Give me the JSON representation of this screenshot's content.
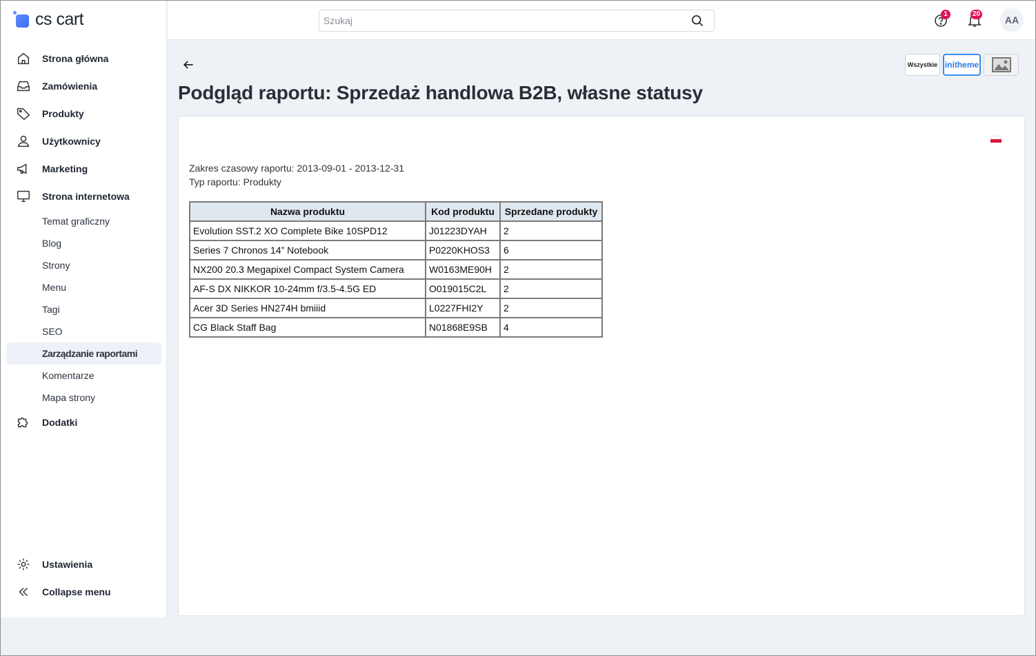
{
  "brand": {
    "name": "cs cart",
    "color": "#3f6ff2"
  },
  "search": {
    "placeholder": "Szukaj"
  },
  "topbar": {
    "help_badge": "1",
    "notifications_badge": "20",
    "avatar_initials": "AA"
  },
  "sidebar": {
    "items": [
      {
        "label": "Strona główna",
        "icon": "home-icon"
      },
      {
        "label": "Zamówienia",
        "icon": "inbox-icon"
      },
      {
        "label": "Produkty",
        "icon": "tag-icon"
      },
      {
        "label": "Użytkownicy",
        "icon": "user-icon"
      },
      {
        "label": "Marketing",
        "icon": "megaphone-icon"
      },
      {
        "label": "Strona internetowa",
        "icon": "monitor-icon"
      }
    ],
    "subitems": [
      {
        "label": "Temat graficzny"
      },
      {
        "label": "Blog"
      },
      {
        "label": "Strony"
      },
      {
        "label": "Menu"
      },
      {
        "label": "Tagi"
      },
      {
        "label": "SEO"
      },
      {
        "label": "Zarządzanie raportami",
        "active": true
      },
      {
        "label": "Komentarze"
      },
      {
        "label": "Mapa strony"
      }
    ],
    "addons": {
      "label": "Dodatki",
      "icon": "puzzle-icon"
    },
    "bottom": [
      {
        "label": "Ustawienia",
        "icon": "gear-icon"
      },
      {
        "label": "Collapse menu",
        "icon": "double-chevron-left-icon"
      }
    ]
  },
  "page": {
    "title": "Podgląd raportu: Sprzedaż handlowa B2B, własne statusy",
    "template_buttons": {
      "all": "Wszystkie",
      "initheme": "initheme",
      "image": "image-icon"
    }
  },
  "report": {
    "period_line": "Zakres czasowy raportu: 2013-09-01 - 2013-12-31",
    "type_line": "Typ raportu: Produkty",
    "columns": [
      "Nazwa produktu",
      "Kod produktu",
      "Sprzedane produkty"
    ],
    "rows": [
      [
        "Evolution SST.2 XO Complete Bike 10SPD12",
        "J01223DYAH",
        "2"
      ],
      [
        "Series 7 Chronos 14” Notebook",
        "P0220KHOS3",
        "6"
      ],
      [
        "NX200 20.3 Megapixel Compact System Camera",
        "W0163ME90H",
        "2"
      ],
      [
        "AF-S DX NIKKOR 10-24mm f/3.5-4.5G ED",
        "O019015C2L",
        "2"
      ],
      [
        "Acer 3D Series HN274H bmiiid",
        "L0227FHI2Y",
        "2"
      ],
      [
        "CG Black Staff Bag",
        "N01868E9SB",
        "4"
      ]
    ],
    "header_bg": "#dfe7ef"
  },
  "colors": {
    "badge": "#e0115f",
    "active_bg": "#eef1f7",
    "page_bg": "#eef1f6"
  }
}
